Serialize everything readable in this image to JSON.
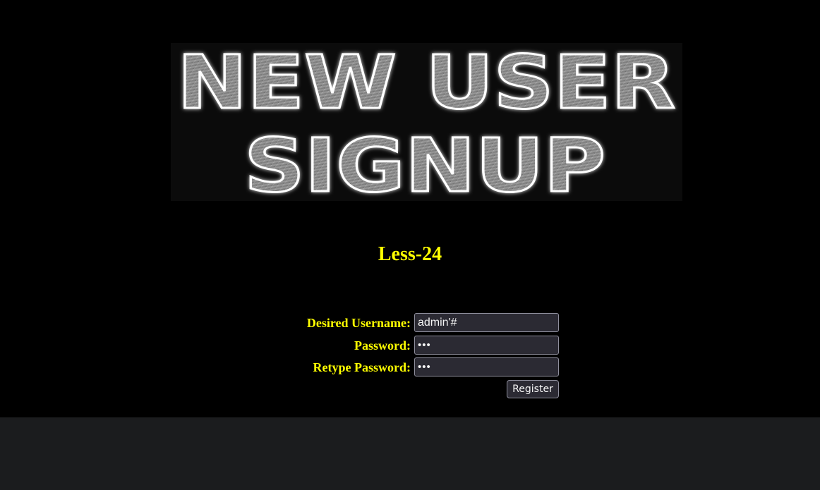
{
  "banner": {
    "line1": "NEW USER",
    "line2": "SIGNUP"
  },
  "level_title": "Less-24",
  "form": {
    "username_label": "Desired Username:",
    "username_value": "admin'#",
    "password_label": "Password:",
    "password_value": "abc",
    "retype_label": "Retype Password:",
    "retype_value": "abc",
    "submit_label": "Register"
  },
  "colors": {
    "background": "#000000",
    "label_text": "#ffff00",
    "input_bg": "#2b2a33",
    "footer_area": "#1b1c1e"
  }
}
